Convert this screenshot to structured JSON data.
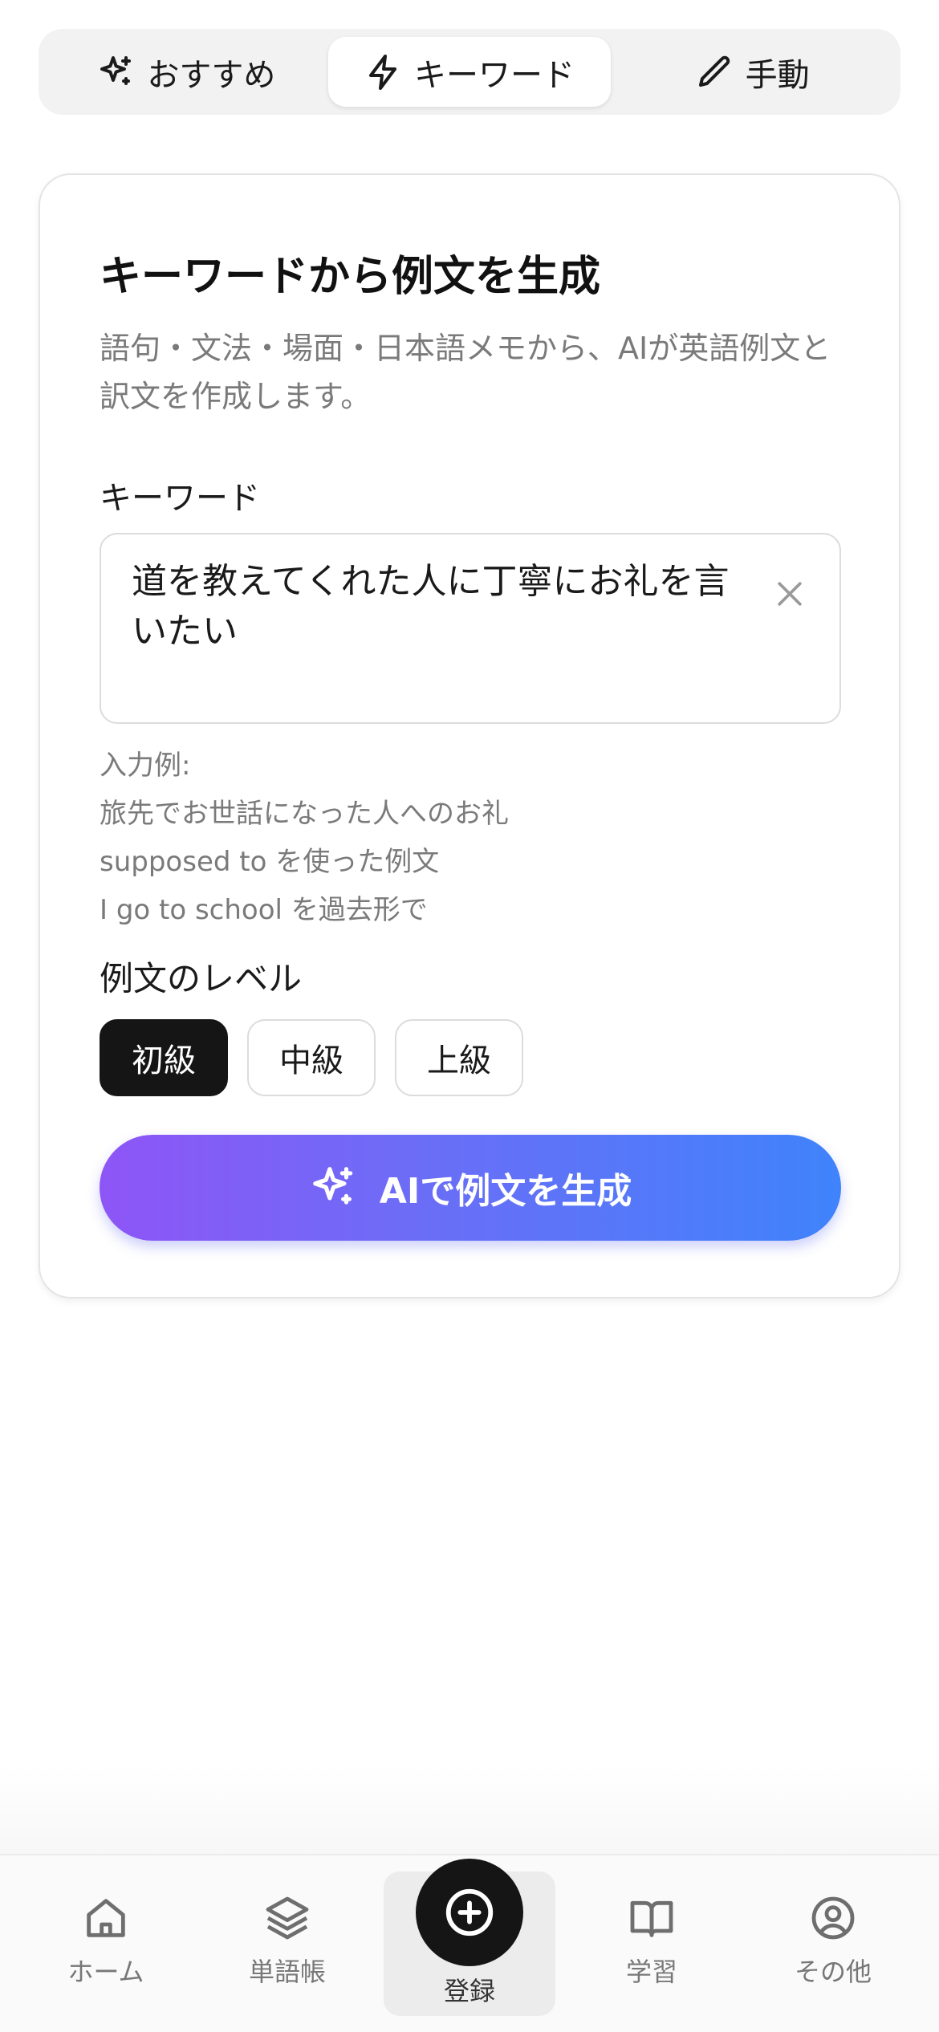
{
  "tabs": [
    {
      "label": "おすすめ",
      "icon": "sparkles-icon",
      "active": false
    },
    {
      "label": "キーワード",
      "icon": "lightning-icon",
      "active": true
    },
    {
      "label": "手動",
      "icon": "pencil-icon",
      "active": false
    }
  ],
  "card": {
    "title": "キーワードから例文を生成",
    "description": "語句・文法・場面・日本語メモから、AIが英語例文と訳文を作成します。",
    "keyword_label": "キーワード",
    "keyword_value": "道を教えてくれた人に丁寧にお礼を言いたい",
    "examples_title": "入力例:",
    "examples": [
      "旅先でお世話になった人へのお礼",
      "supposed to を使った例文",
      "I go to school を過去形で"
    ],
    "level_label": "例文のレベル",
    "levels": [
      {
        "label": "初級",
        "active": true
      },
      {
        "label": "中級",
        "active": false
      },
      {
        "label": "上級",
        "active": false
      }
    ],
    "generate_label": "AIで例文を生成"
  },
  "nav": {
    "items": [
      {
        "label": "ホーム",
        "icon": "home-icon"
      },
      {
        "label": "単語帳",
        "icon": "layers-icon"
      },
      {
        "label": "登録",
        "icon": "plus-circle-icon"
      },
      {
        "label": "学習",
        "icon": "book-icon"
      },
      {
        "label": "その他",
        "icon": "user-circle-icon"
      }
    ]
  },
  "colors": {
    "gradient_start": "#8e55f6",
    "gradient_end": "#3f83fb",
    "active_level": "#151515"
  }
}
